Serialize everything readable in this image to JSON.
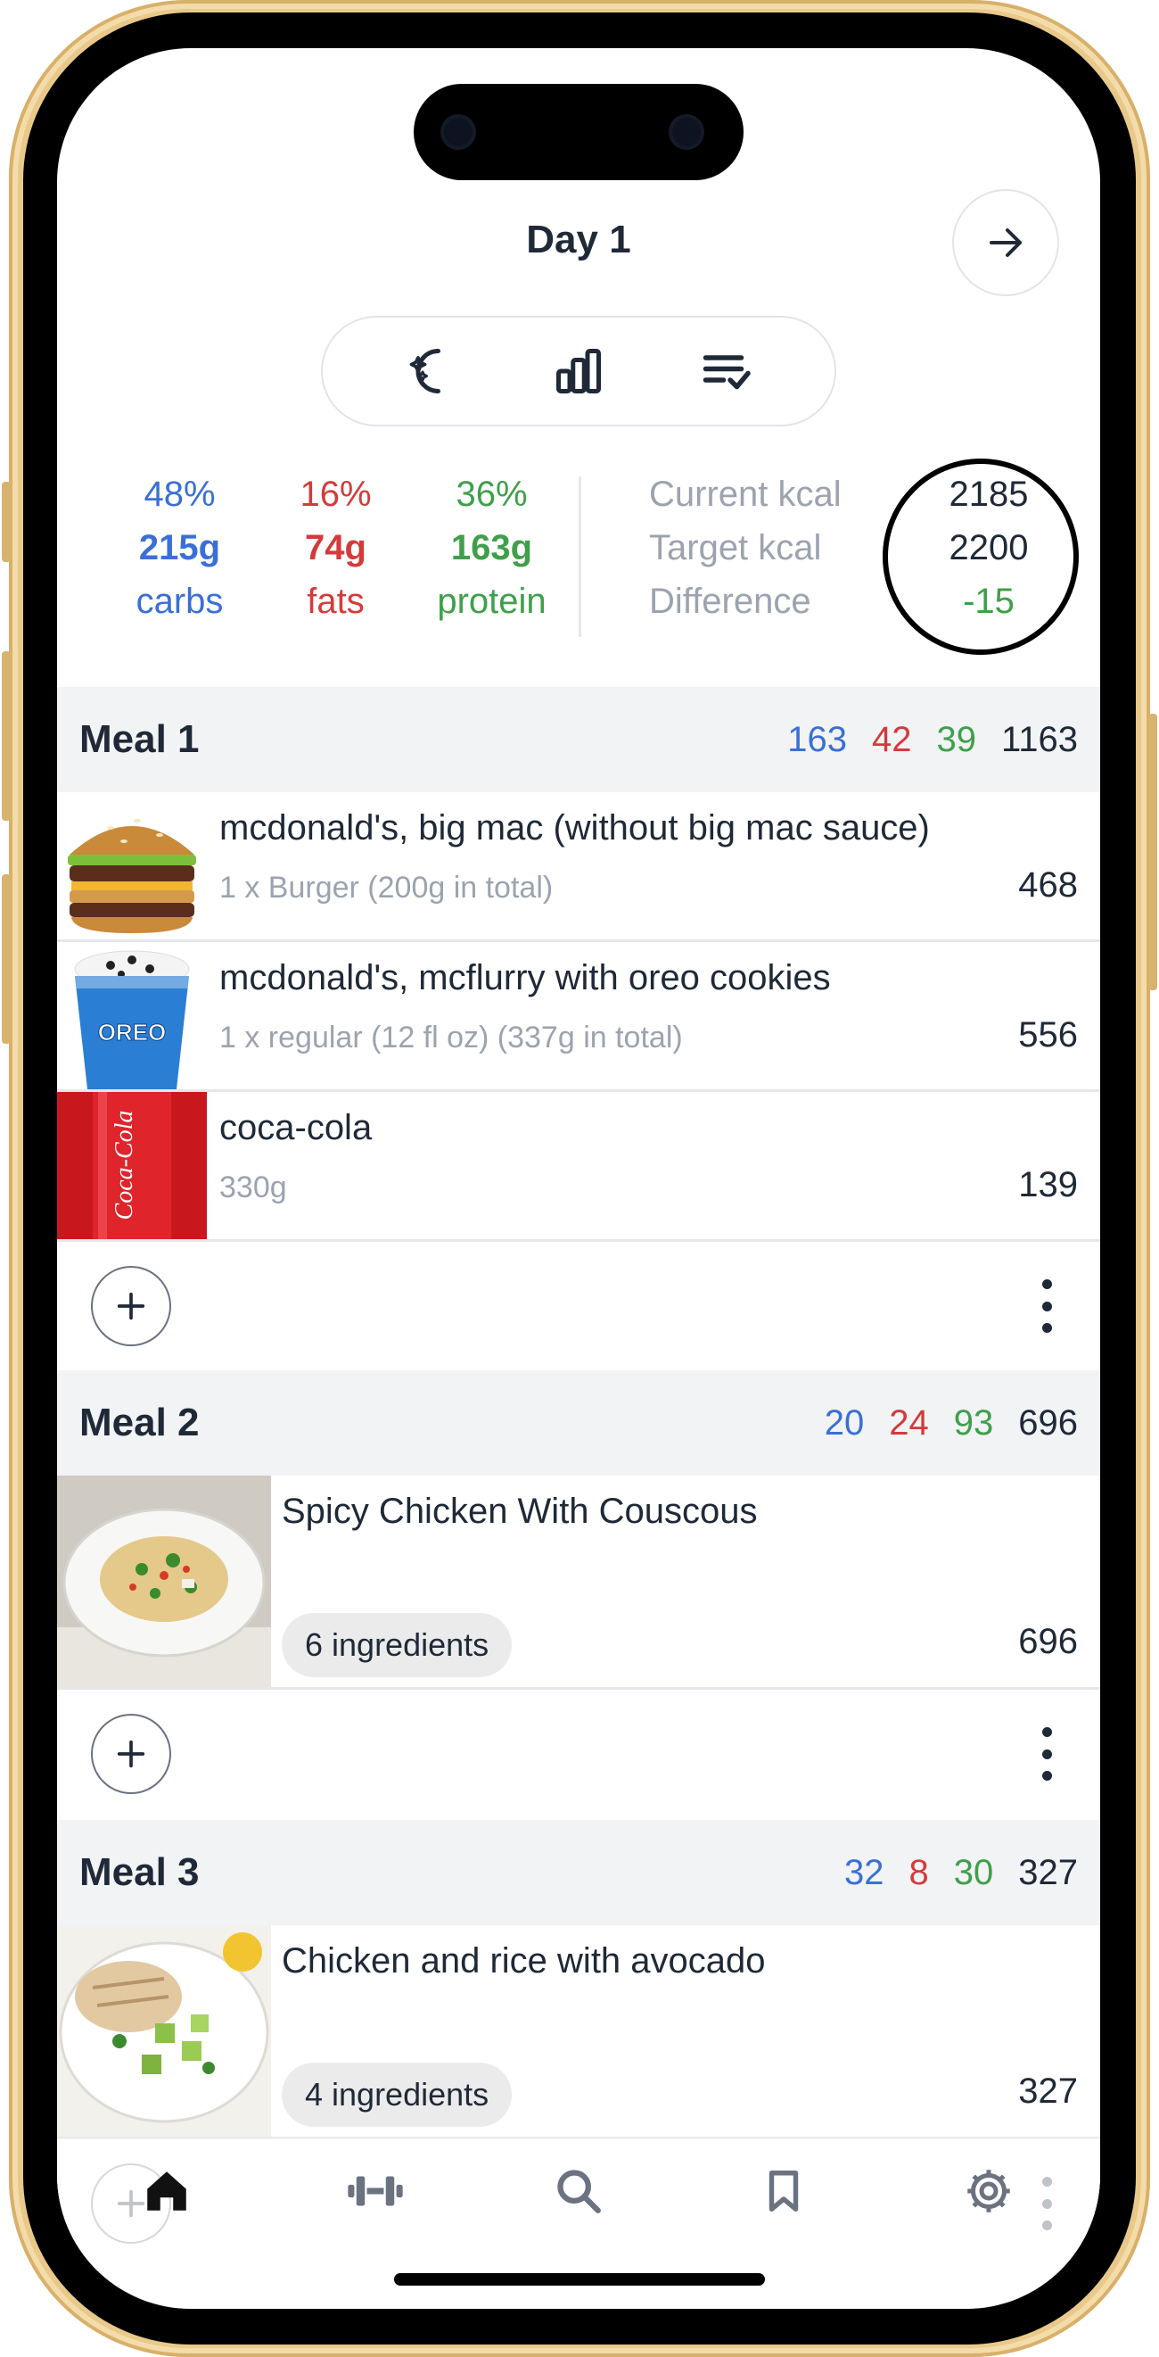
{
  "header": {
    "title": "Day 1"
  },
  "icons": {
    "next": "arrow-right-icon",
    "seg": [
      "magic-moon-icon",
      "bar-chart-icon",
      "checklist-icon"
    ],
    "add": "plus-icon",
    "more": "more-vertical-icon",
    "tabs": [
      "home-icon",
      "dumbbell-icon",
      "search-icon",
      "bookmark-icon",
      "gear-icon"
    ]
  },
  "summary": {
    "carbs": {
      "pct": "48%",
      "grams": "215g",
      "label": "carbs"
    },
    "fats": {
      "pct": "16%",
      "grams": "74g",
      "label": "fats"
    },
    "protein": {
      "pct": "36%",
      "grams": "163g",
      "label": "protein"
    },
    "current_label": "Current kcal",
    "target_label": "Target kcal",
    "difference_label": "Difference",
    "current_value": "2185",
    "target_value": "2200",
    "difference_value": "-15"
  },
  "meals": [
    {
      "name": "Meal 1",
      "carbs": "163",
      "fats": "42",
      "protein": "39",
      "kcal": "1163",
      "items": [
        {
          "name": "mcdonald's, big mac (without big mac sauce)",
          "sub": "1 x Burger (200g in total)",
          "kcal": "468"
        },
        {
          "name": "mcdonald's, mcflurry with oreo cookies",
          "sub": "1 x regular (12 fl oz) (337g in total)",
          "kcal": "556",
          "cup_text": "OREO"
        },
        {
          "name": "coca-cola",
          "sub": "330g",
          "kcal": "139",
          "can_text": "Coca-Cola"
        }
      ]
    },
    {
      "name": "Meal 2",
      "carbs": "20",
      "fats": "24",
      "protein": "93",
      "kcal": "696",
      "items": [
        {
          "name": "Spicy Chicken With Couscous",
          "pill": "6 ingredients",
          "kcal": "696"
        }
      ]
    },
    {
      "name": "Meal 3",
      "carbs": "32",
      "fats": "8",
      "protein": "30",
      "kcal": "327",
      "items": [
        {
          "name": "Chicken and rice with avocado",
          "pill": "4 ingredients",
          "kcal": "327"
        }
      ]
    }
  ],
  "colors": {
    "carbs": "#3b6fd6",
    "fats": "#d33b3b",
    "protein": "#3f9f4a",
    "frame": "#e9c98a"
  }
}
